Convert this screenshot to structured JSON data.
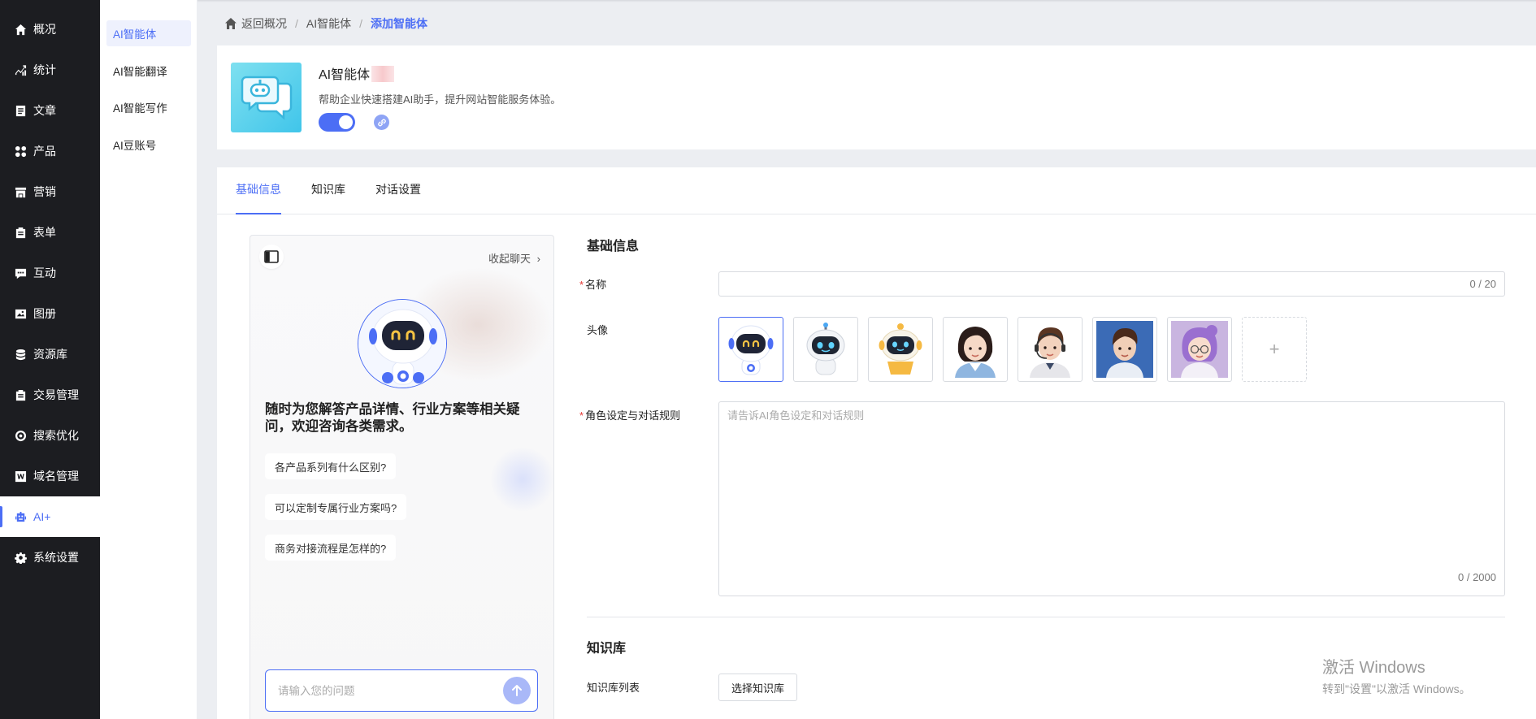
{
  "nav": {
    "items": [
      {
        "label": "概况",
        "icon": "home-icon"
      },
      {
        "label": "统计",
        "icon": "chart-icon"
      },
      {
        "label": "文章",
        "icon": "article-icon"
      },
      {
        "label": "产品",
        "icon": "grid-icon"
      },
      {
        "label": "营销",
        "icon": "shop-icon"
      },
      {
        "label": "表单",
        "icon": "clipboard-icon"
      },
      {
        "label": "互动",
        "icon": "chat-bubble-icon"
      },
      {
        "label": "图册",
        "icon": "gallery-icon"
      },
      {
        "label": "资源库",
        "icon": "database-icon"
      },
      {
        "label": "交易管理",
        "icon": "clipboard-icon"
      },
      {
        "label": "搜索优化",
        "icon": "target-icon"
      },
      {
        "label": "域名管理",
        "icon": "w-icon"
      },
      {
        "label": "AI+",
        "icon": "robot-icon"
      },
      {
        "label": "系统设置",
        "icon": "gear-icon"
      }
    ],
    "active": "AI+"
  },
  "subnav": {
    "items": [
      "AI智能体",
      "AI智能翻译",
      "AI智能写作",
      "AI豆账号"
    ],
    "active": "AI智能体"
  },
  "breadcrumb": {
    "home": "返回概况",
    "mid": "AI智能体",
    "current": "添加智能体"
  },
  "agent": {
    "name": "AI智能体",
    "description": "帮助企业快速搭建AI助手，提升网站智能服务体验。",
    "enabled": true
  },
  "tabs": [
    "基础信息",
    "知识库",
    "对话设置"
  ],
  "active_tab": "基础信息",
  "chat": {
    "collapse_label": "收起聊天",
    "greeting": "随时为您解答产品详情、行业方案等相关疑问，欢迎咨询各类需求。",
    "questions": [
      "各产品系列有什么区别?",
      "可以定制专属行业方案吗?",
      "商务对接流程是怎样的?"
    ],
    "input_placeholder": "请输入您的问题"
  },
  "form": {
    "basic_title": "基础信息",
    "name_label": "名称",
    "name_value": "",
    "name_counter": "0 / 20",
    "avatar_label": "头像",
    "avatar_add": "+",
    "rules_label": "角色设定与对话规则",
    "rules_placeholder": "请告诉AI角色设定和对话规则",
    "rules_counter": "0 / 2000",
    "kb_title": "知识库",
    "kb_label": "知识库列表",
    "kb_button": "选择知识库"
  },
  "watermark": {
    "line1": "激活 Windows",
    "line2": "转到\"设置\"以激活 Windows。"
  },
  "colors": {
    "accent": "#4c6ef5",
    "nav_bg": "#1c1d21"
  }
}
